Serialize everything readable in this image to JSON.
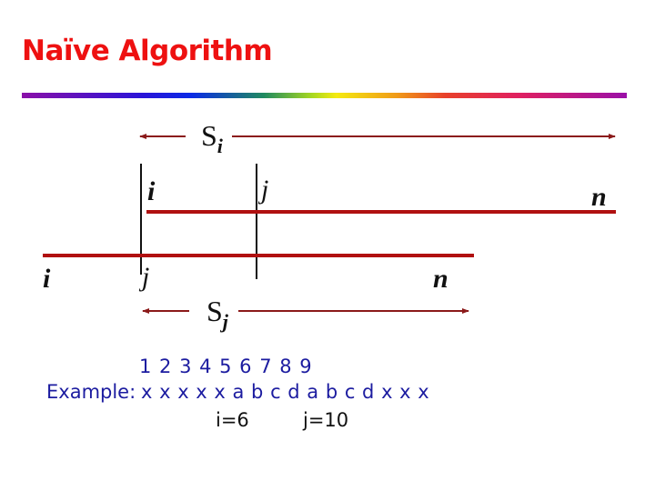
{
  "slide": {
    "title": "Naïve Algorithm",
    "title_color": "#ee1111"
  },
  "diagram": {
    "top_span": {
      "label_main": "S",
      "label_sub": "i"
    },
    "top_row": {
      "left_label": "i",
      "mid_label": "j",
      "right_label": "n"
    },
    "bottom_row": {
      "left_label": "i",
      "mid_label": "j",
      "right_label": "n"
    },
    "bottom_span": {
      "label_main": "S",
      "label_sub": "j"
    },
    "line_color": "#b01010",
    "arrow_color": "#8b1a1a"
  },
  "example": {
    "label": "Example:",
    "indices": "1 2 3 4 5 6 7 8 9",
    "sequence": "x x x x x a b c d a b c d x x x",
    "i_value": "i=6",
    "j_value": "j=10",
    "text_color": "#1c1ca0"
  }
}
